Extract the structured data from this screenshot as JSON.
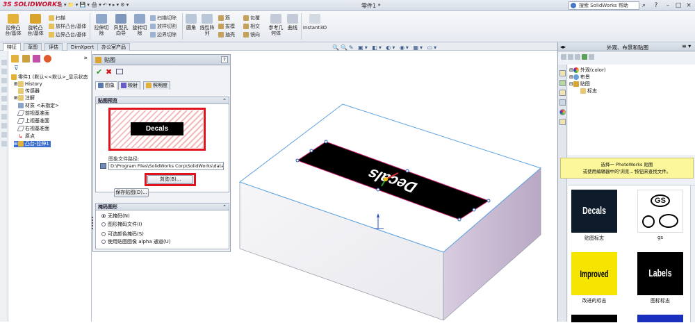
{
  "window": {
    "app_name": "SOLIDWORKS",
    "doc_title": "零件1 *",
    "search_placeholder": "搜索 SolidWorks 帮助",
    "controls": [
      "?",
      "–",
      "□",
      "×"
    ]
  },
  "ribbon": {
    "big_buttons": [
      {
        "label": "拉伸凸\n台/基体"
      },
      {
        "label": "旋转凸\n台/基体"
      },
      {
        "label": "拉伸切\n除"
      },
      {
        "label": "异型孔\n向导"
      },
      {
        "label": "旋转切\n除"
      },
      {
        "label": "圆角"
      },
      {
        "label": "线性阵\n列"
      },
      {
        "label": "参考几\n何体"
      },
      {
        "label": "曲线"
      },
      {
        "label": "Instant3D"
      }
    ],
    "small_buttons_col1": [
      "扫描",
      "放样凸台/基体",
      "边界凸台/基体"
    ],
    "small_buttons_col2": [
      "扫描切除",
      "放样切割",
      "边界切除"
    ],
    "small_buttons_col3": [
      "筋",
      "拔模",
      "抽壳"
    ],
    "small_buttons_col4": [
      "包覆",
      "相交",
      "镜向"
    ]
  },
  "tabs": [
    "特征",
    "草图",
    "评估",
    "DimXpert",
    "办公室产品"
  ],
  "feature_tree": {
    "root": "零件1 (默认<<默认>_显示状态",
    "items": [
      "History",
      "传感器",
      "注解",
      "材质 <未指定>",
      "前视基准面",
      "上视基准面",
      "右视基准面",
      "原点",
      "凸台-拉伸1"
    ]
  },
  "property_manager": {
    "title": "贴图",
    "tabs": [
      "图象",
      "映射",
      "照明度"
    ],
    "preview_group": "贴图预览",
    "decal_text": "Decals",
    "path_label": "图象文件路径:",
    "path_value": "D:\\Program Files\\SolidWorks Corp\\SolidWorks\\data\\",
    "browse_button": "浏览(B)...",
    "save_button": "保存贴图(D)...",
    "mask_group": "掩码图形",
    "mask_options": [
      {
        "label": "无掩码(N)",
        "selected": true
      },
      {
        "label": "图形掩码文件(I)",
        "selected": false
      },
      {
        "label": "可选颜色掩码(S)",
        "selected": false
      },
      {
        "label": "使用贴图图像 alpha 通道(U)",
        "selected": false
      }
    ]
  },
  "viewport": {
    "decal_text": "Decals"
  },
  "task_pane": {
    "title": "外观、布景和贴图",
    "tree": [
      "外观(color)",
      "布景",
      "贴图",
      "标志"
    ],
    "info_line1": "选择一 PhotoWorks 贴图",
    "info_line2": "或使用编辑器中的'浏览...'按钮来查找文件。",
    "tiles": [
      {
        "caption": "贴图标志",
        "text": "Decals",
        "bg": "#0d1b2a",
        "fg": "#ffffff"
      },
      {
        "caption": "gs",
        "text": "GS",
        "bg": "#ffffff",
        "fg": "#000000"
      },
      {
        "caption": "改进的标志",
        "text": "Improved",
        "bg": "#f5e500",
        "fg": "#000000"
      },
      {
        "caption": "图标标志",
        "text": "Labels",
        "bg": "#000000",
        "fg": "#ffffff"
      }
    ]
  },
  "colors": {
    "accent_red": "#e0141e",
    "info_yellow": "#fbf79a",
    "box_face": "#ffffff",
    "box_side": "#c9b9d1"
  }
}
